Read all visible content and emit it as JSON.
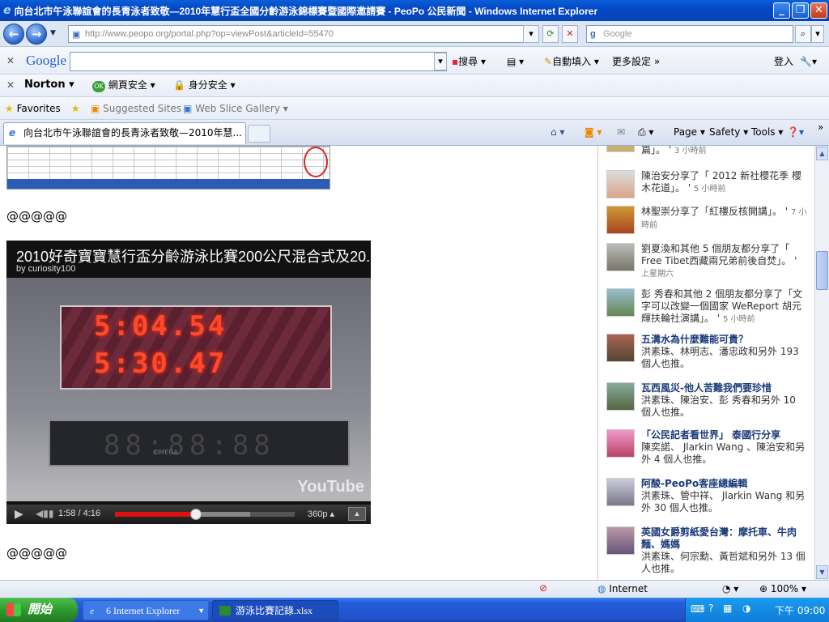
{
  "window": {
    "title": "向台北市午泳聯誼會的長青泳者致敬—2010年慧行盃全國分齡游泳錦標賽暨國際邀請賽 - PeoPo 公民新聞 - Windows Internet Explorer"
  },
  "address": {
    "url": "http://www.peopo.org/portal.php?op=viewPost&articleId=55470",
    "search_placeholder": "Google"
  },
  "google_toolbar": {
    "logo": "Google",
    "search_label": "搜尋",
    "autofill_label": "自動填入",
    "more_settings": "更多設定 »",
    "login": "登入"
  },
  "norton_toolbar": {
    "logo": "Norton",
    "web_safety": "網頁安全",
    "identity_safety": "身分安全"
  },
  "favorites_bar": {
    "favorites": "Favorites",
    "suggested": "Suggested Sites",
    "webslice": "Web Slice Gallery"
  },
  "tab": {
    "title": "向台北市午泳聯誼會的長青泳者致敬—2010年慧..."
  },
  "commands": {
    "page": "Page",
    "safety": "Safety",
    "tools": "Tools"
  },
  "article": {
    "sep1": "@@@@@",
    "sep2": "@@@@@"
  },
  "video": {
    "title": "2010好奇寶寶慧行盃分齡游泳比賽200公尺混合式及20...",
    "by": "by curiosity100",
    "time": "1:58 / 4:16",
    "quality": "360p",
    "progress_played": 0.45,
    "progress_buffered": 0.75,
    "brand": "YouTube",
    "board_line1": "5:04.54",
    "board_line2": "5:30.47",
    "board_lower": "88:88:88",
    "omega": "OMEGA"
  },
  "feed": [
    {
      "text": "篇」。",
      "time": "3 小時前"
    },
    {
      "text": "陳治安分享了「 2012 新社櫻花季 櫻木花道」。",
      "time": "5 小時前"
    },
    {
      "text": "林聖崇分享了「紅樓反核開講」。",
      "time": "7 小時前"
    },
    {
      "text": "劉夏渙和其他 5 個朋友都分享了「 Free Tibet西藏兩兄弟前後自焚」。",
      "time": "上星期六"
    },
    {
      "text": "彭 秀春和其他 2 個朋友都分享了「文字可以改變一個國家 WeReport 胡元輝扶輪社演講」。",
      "time": "5 小時前"
    },
    {
      "title": "五溝水為什麼難能可貴？",
      "text": "洪素珠、林明志、潘忠政和另外 193 個人也推。"
    },
    {
      "title": "瓦西風災-他人苦難我們要珍惜",
      "text": "洪素珠、陳治安、彭 秀春和另外 10 個人也推。"
    },
    {
      "title": "「公民記者看世界」 泰國行分享",
      "text": "陳奕諾、 Jlarkin Wang 、陳治安和另外 4 個人也推。"
    },
    {
      "title": "阿酸-PeoPo客座總編輯",
      "text": "洪素珠、管中祥、 Jlarkin Wang 和另外 30 個人也推。"
    },
    {
      "title": "英國女爵剪紙愛台灣：摩托車、牛肉麵、媽媽",
      "text": "洪素珠、何宗勳、黃哲斌和另外 13 個人也推。"
    }
  ],
  "status": {
    "zone": "Internet",
    "zoom": "100%"
  },
  "taskbar": {
    "start": "開始",
    "ie_task": "6 Internet Explorer",
    "excel_task": "游泳比賽記錄.xlsx",
    "clock": "下午 09:00"
  },
  "colors": {
    "title_blue": "#0548c4",
    "taskbar_blue": "#245edb",
    "start_green": "#2e9b2e",
    "led_red": "#ff4a2a",
    "progress_red": "#dd1111"
  }
}
